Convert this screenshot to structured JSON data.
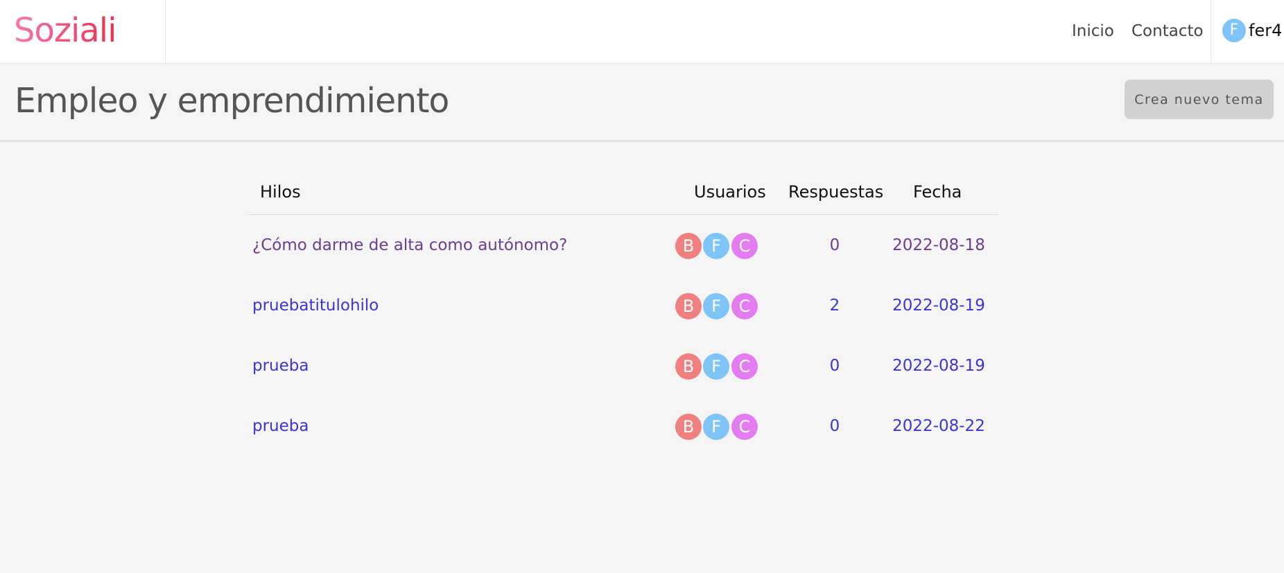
{
  "header": {
    "brand": "Soziali",
    "nav": {
      "inicio": "Inicio",
      "contacto": "Contacto"
    },
    "user": {
      "avatar_letter": "F",
      "name": "fer4",
      "avatar_color": "#7fc4f7"
    }
  },
  "page": {
    "title": "Empleo y emprendimiento",
    "new_topic_button": "Crea nuevo tema"
  },
  "table": {
    "headers": {
      "threads": "Hilos",
      "users": "Usuarios",
      "replies": "Respuestas",
      "date": "Fecha"
    },
    "rows": [
      {
        "title": "¿Cómo darme de alta como autónomo?",
        "users": [
          "B",
          "F",
          "C"
        ],
        "replies": "0",
        "date": "2022-08-18",
        "visited": true
      },
      {
        "title": "pruebatitulohilo",
        "users": [
          "B",
          "F",
          "C"
        ],
        "replies": "2",
        "date": "2022-08-19",
        "visited": false
      },
      {
        "title": "prueba",
        "users": [
          "B",
          "F",
          "C"
        ],
        "replies": "0",
        "date": "2022-08-19",
        "visited": false
      },
      {
        "title": "prueba",
        "users": [
          "B",
          "F",
          "C"
        ],
        "replies": "0",
        "date": "2022-08-22",
        "visited": false
      }
    ]
  },
  "colors": {
    "brand_gradient": [
      "#f47aa8",
      "#e8334f"
    ],
    "link": "#3b34d6",
    "link_visited": "#6b3d8f",
    "avatar_b": "#f08080",
    "avatar_f": "#7fc4f7",
    "avatar_c": "#e37cf0",
    "button_bg": "#d1d1d1"
  }
}
